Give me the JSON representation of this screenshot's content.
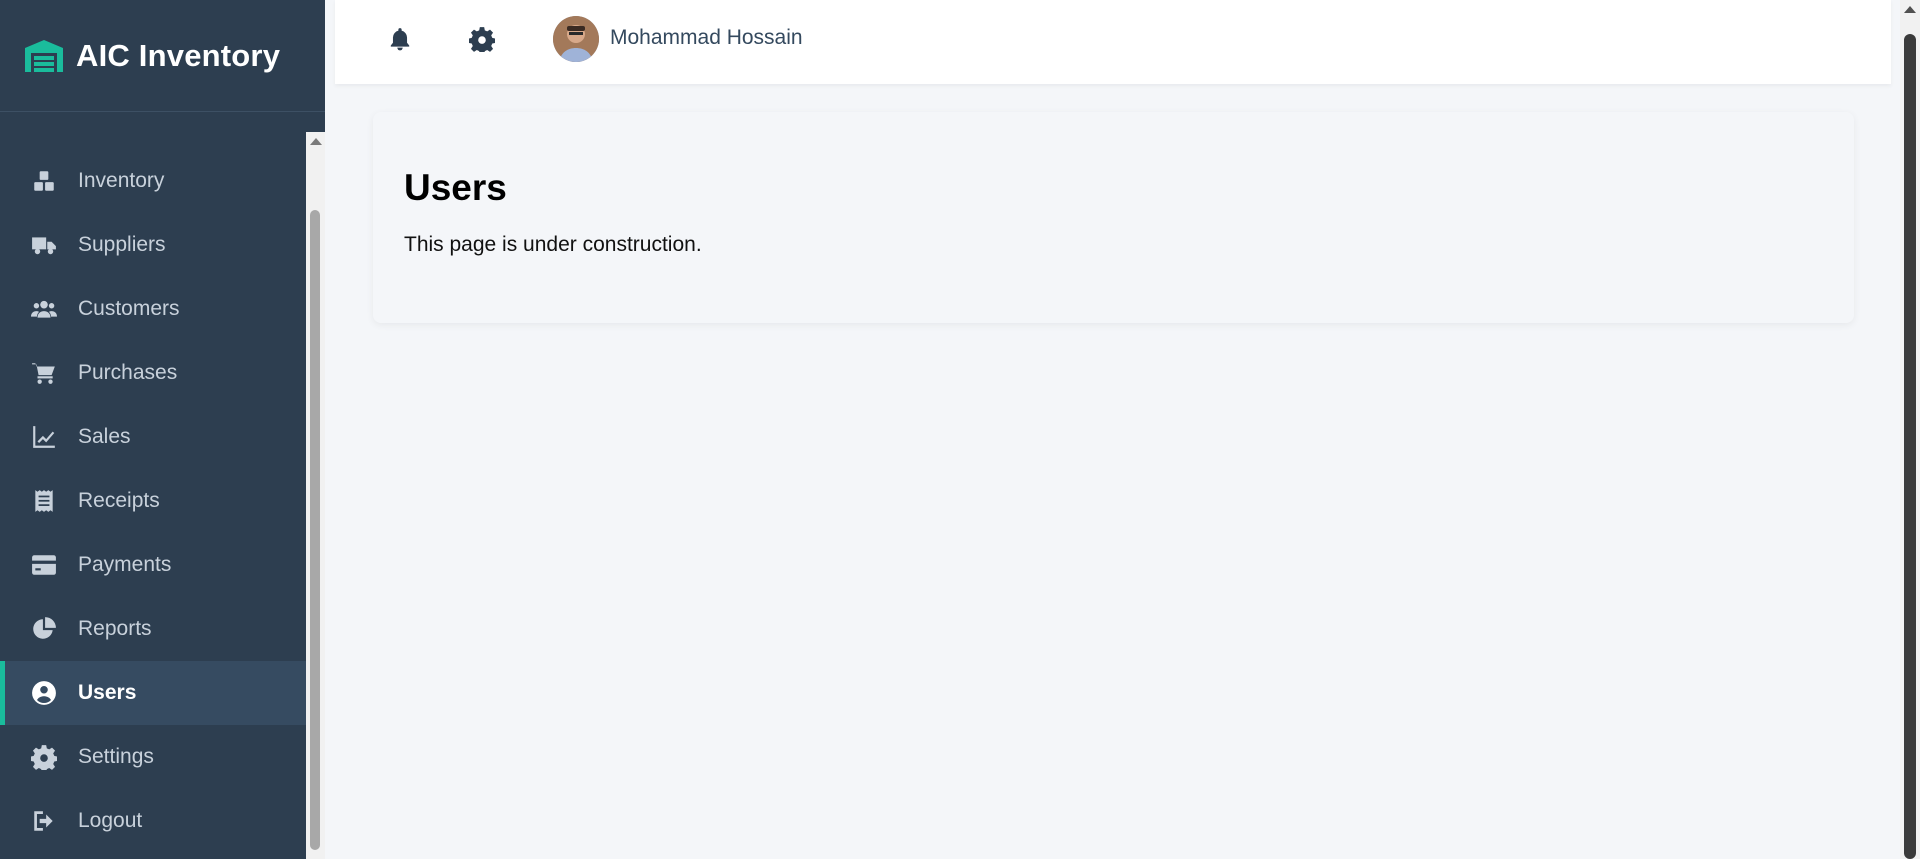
{
  "app": {
    "title": "AIC Inventory",
    "brand_icon": "warehouse-icon",
    "accent_color": "#1abc9c",
    "sidebar_color": "#2d3e50"
  },
  "sidebar": {
    "items": [
      {
        "label": "Inventory",
        "icon": "boxes-icon",
        "active": false
      },
      {
        "label": "Suppliers",
        "icon": "truck-icon",
        "active": false
      },
      {
        "label": "Customers",
        "icon": "users-icon",
        "active": false
      },
      {
        "label": "Purchases",
        "icon": "cart-icon",
        "active": false
      },
      {
        "label": "Sales",
        "icon": "chart-line-icon",
        "active": false
      },
      {
        "label": "Receipts",
        "icon": "receipt-icon",
        "active": false
      },
      {
        "label": "Payments",
        "icon": "credit-card-icon",
        "active": false
      },
      {
        "label": "Reports",
        "icon": "pie-chart-icon",
        "active": false
      },
      {
        "label": "Users",
        "icon": "user-circle-icon",
        "active": true
      },
      {
        "label": "Settings",
        "icon": "gear-icon",
        "active": false
      },
      {
        "label": "Logout",
        "icon": "logout-icon",
        "active": false
      }
    ]
  },
  "header": {
    "notification_icon": "bell-icon",
    "settings_icon": "gear-icon",
    "user_name": "Mohammad Hossain"
  },
  "main": {
    "title": "Users",
    "message": "This page is under construction."
  }
}
